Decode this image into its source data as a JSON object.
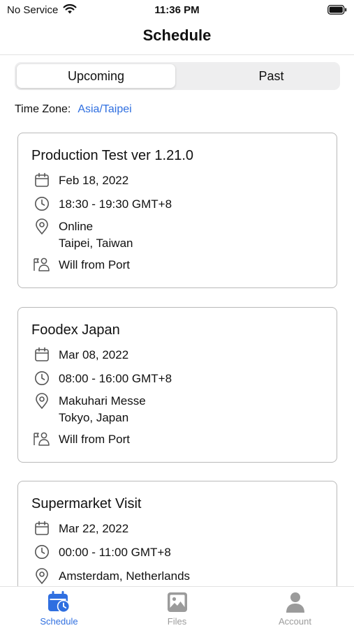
{
  "status_bar": {
    "carrier": "No Service",
    "time": "11:36 PM"
  },
  "nav": {
    "title": "Schedule"
  },
  "segments": [
    {
      "label": "Upcoming",
      "selected": true
    },
    {
      "label": "Past",
      "selected": false
    }
  ],
  "timezone": {
    "label": "Time Zone:",
    "value": "Asia/Taipei"
  },
  "events": [
    {
      "title": "Production Test ver 1.21.0",
      "date": "Feb 18, 2022",
      "time": "18:30 - 19:30 GMT+8",
      "location_line1": "Online",
      "location_line2": "Taipei, Taiwan",
      "host": "Will from Port"
    },
    {
      "title": "Foodex Japan",
      "date": "Mar 08, 2022",
      "time": "08:00 - 16:00 GMT+8",
      "location_line1": "Makuhari Messe",
      "location_line2": "Tokyo, Japan",
      "host": "Will from Port"
    },
    {
      "title": "Supermarket Visit",
      "date": "Mar 22, 2022",
      "time": "00:00 - 11:00 GMT+8",
      "location_line1": "Amsterdam, Netherlands",
      "location_line2": "",
      "host": ""
    }
  ],
  "tab_bar": {
    "tabs": [
      {
        "label": "Schedule",
        "icon": "calendar-clock-icon",
        "selected": true
      },
      {
        "label": "Files",
        "icon": "image-icon",
        "selected": false
      },
      {
        "label": "Account",
        "icon": "person-icon",
        "selected": false
      }
    ]
  },
  "colors": {
    "accent": "#2f6fe0",
    "tab_inactive": "#9b9b9b",
    "card_border": "#b9b9b9"
  }
}
